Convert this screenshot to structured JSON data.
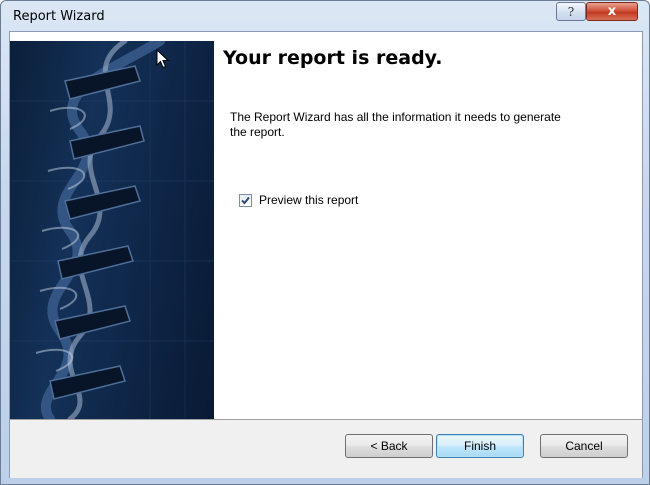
{
  "window": {
    "title": "Report Wizard",
    "help_glyph": "?",
    "close_glyph": "x"
  },
  "main": {
    "heading": "Your report is ready.",
    "description": "The Report Wizard has all the information it needs to generate the report.",
    "preview_checkbox": {
      "label": "Preview this report",
      "checked": true
    }
  },
  "buttons": {
    "back": "< Back",
    "finish": "Finish",
    "cancel": "Cancel"
  },
  "icons": {
    "side_image": "dna-helix-image",
    "cursor": "mouse-pointer-icon",
    "checkmark": "checkmark-icon"
  },
  "colors": {
    "title_gradient": "#c6d7ee",
    "close_button": "#c23a20",
    "default_button_border": "#3c7fb1",
    "side_image_dark": "#0b1f3a"
  }
}
